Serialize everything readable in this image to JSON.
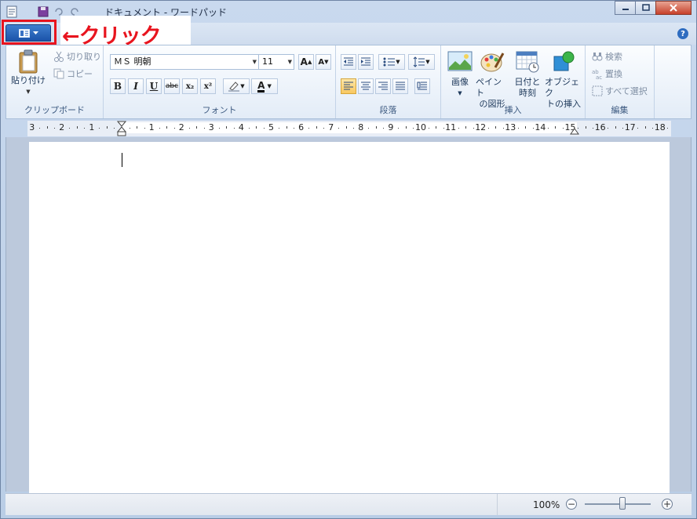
{
  "window": {
    "title": "ドキュメント - ワードパッド"
  },
  "annotation": {
    "callout_text": "←クリック",
    "highlight_color": "#e8141e"
  },
  "ribbon": {
    "clipboard": {
      "group_label": "クリップボード",
      "paste_label": "貼り付け",
      "cut_label": "切り取り",
      "copy_label": "コピー"
    },
    "font": {
      "group_label": "フォント",
      "font_name": "ＭＳ 明朝",
      "font_size": "11",
      "bold": "B",
      "italic": "I",
      "underline": "U",
      "strikethrough": "abc",
      "subscript": "x₂",
      "superscript": "x²",
      "grow_font": "A",
      "shrink_font": "A",
      "text_color": "A"
    },
    "paragraph": {
      "group_label": "段落"
    },
    "insert": {
      "group_label": "挿入",
      "picture_label": "画像",
      "paint_label_1": "ペイント",
      "paint_label_2": "の図形",
      "datetime_label_1": "日付と",
      "datetime_label_2": "時刻",
      "object_label_1": "オブジェク",
      "object_label_2": "トの挿入"
    },
    "editing": {
      "group_label": "編集",
      "find_label": "検索",
      "replace_label": "置換",
      "select_all_label": "すべて選択"
    }
  },
  "ruler": {
    "labels": [
      "3",
      "2",
      "1",
      "1",
      "2",
      "3",
      "4",
      "5",
      "6",
      "7",
      "8",
      "9",
      "10",
      "11",
      "12",
      "13",
      "14",
      "15",
      "16",
      "17",
      "18"
    ]
  },
  "status": {
    "zoom": "100%",
    "zoom_level": 1.0
  }
}
